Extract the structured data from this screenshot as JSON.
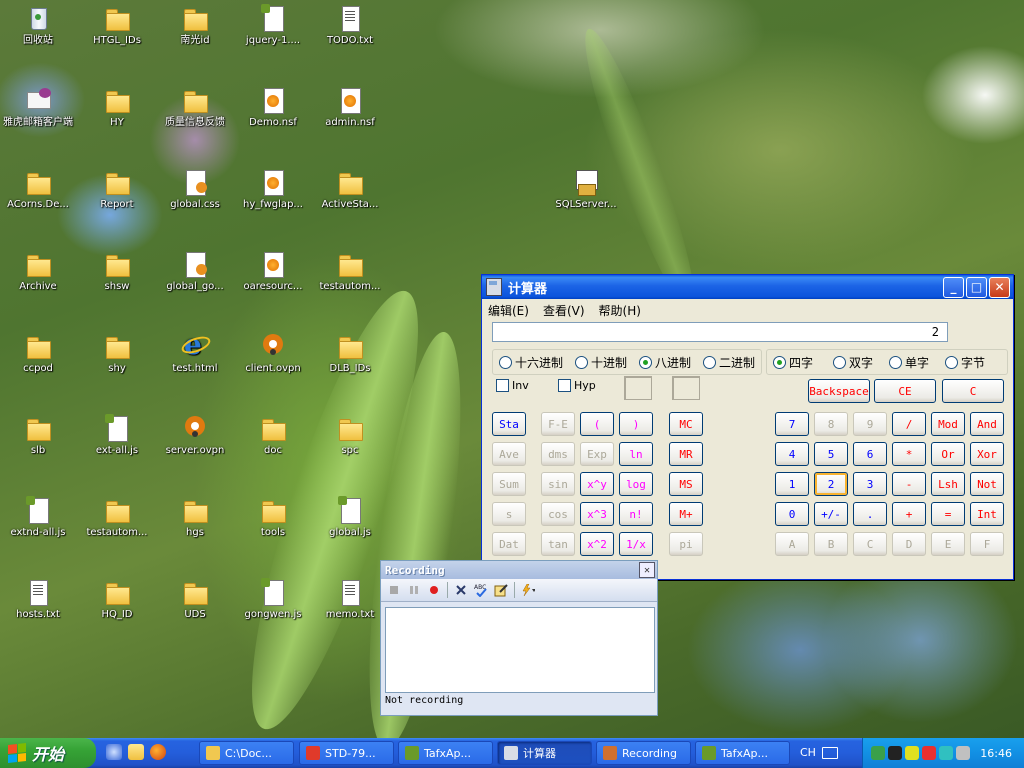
{
  "desktop": {
    "icons": [
      {
        "label": "回收站",
        "type": "recycle"
      },
      {
        "label": "HTGL_IDs",
        "type": "folder"
      },
      {
        "label": "南光id",
        "type": "folder"
      },
      {
        "label": "jquery-1....",
        "type": "js"
      },
      {
        "label": "TODO.txt",
        "type": "txt"
      },
      {
        "label": "雅虎邮箱客户端",
        "type": "mail"
      },
      {
        "label": "HY",
        "type": "folder"
      },
      {
        "label": "质量信息反馈",
        "type": "folder"
      },
      {
        "label": "Demo.nsf",
        "type": "nsf"
      },
      {
        "label": "admin.nsf",
        "type": "nsf"
      },
      {
        "label": "ACorns.De...",
        "type": "folder"
      },
      {
        "label": "Report",
        "type": "folder"
      },
      {
        "label": "global.css",
        "type": "css"
      },
      {
        "label": "hy_fwglap...",
        "type": "nsf"
      },
      {
        "label": "ActiveSta...",
        "type": "folder"
      },
      {
        "label": "SQLServer...",
        "type": "sql"
      },
      {
        "label": "Archive",
        "type": "folder"
      },
      {
        "label": "shsw",
        "type": "folder"
      },
      {
        "label": "global_go...",
        "type": "css"
      },
      {
        "label": "oaresourc...",
        "type": "nsf"
      },
      {
        "label": "testautom...",
        "type": "folder"
      },
      {
        "label": "ccpod",
        "type": "folder"
      },
      {
        "label": "shy",
        "type": "folder"
      },
      {
        "label": "test.html",
        "type": "ie"
      },
      {
        "label": "client.ovpn",
        "type": "vpn"
      },
      {
        "label": "DLB_IDs",
        "type": "folder"
      },
      {
        "label": "slb",
        "type": "folder"
      },
      {
        "label": "ext-all.js",
        "type": "js"
      },
      {
        "label": "server.ovpn",
        "type": "vpn"
      },
      {
        "label": "doc",
        "type": "folder"
      },
      {
        "label": "spc",
        "type": "folder"
      },
      {
        "label": "extnd-all.js",
        "type": "js"
      },
      {
        "label": "testautom...",
        "type": "folder"
      },
      {
        "label": "hgs",
        "type": "folder"
      },
      {
        "label": "tools",
        "type": "folder"
      },
      {
        "label": "global.js",
        "type": "js"
      },
      {
        "label": "hosts.txt",
        "type": "txt"
      },
      {
        "label": "HQ_ID",
        "type": "folder"
      },
      {
        "label": "UDS",
        "type": "folder"
      },
      {
        "label": "gongwen.js",
        "type": "js"
      },
      {
        "label": "memo.txt",
        "type": "txt"
      }
    ]
  },
  "calculator": {
    "title": "计算器",
    "menu": [
      "编辑(E)",
      "查看(V)",
      "帮助(H)"
    ],
    "display": "2",
    "base_options": [
      "十六进制",
      "十进制",
      "八进制",
      "二进制"
    ],
    "base_selected": "八进制",
    "word_options": [
      "四字",
      "双字",
      "单字",
      "字节"
    ],
    "word_selected": "四字",
    "inv_label": "Inv",
    "hyp_label": "Hyp",
    "backspace": "Backspace",
    "ce": "CE",
    "c": "C",
    "sci_buttons": [
      [
        "Sta",
        "F-E",
        "(",
        ")"
      ],
      [
        "Ave",
        "dms",
        "Exp",
        "ln"
      ],
      [
        "Sum",
        "sin",
        "x^y",
        "log"
      ],
      [
        "s",
        "cos",
        "x^3",
        "n!"
      ],
      [
        "Dat",
        "tan",
        "x^2",
        "1/x"
      ]
    ],
    "mem_buttons": [
      "MC",
      "MR",
      "MS",
      "M+",
      "pi"
    ],
    "num_buttons": [
      [
        "7",
        "8",
        "9",
        "/",
        "Mod",
        "And"
      ],
      [
        "4",
        "5",
        "6",
        "*",
        "Or",
        "Xor"
      ],
      [
        "1",
        "2",
        "3",
        "-",
        "Lsh",
        "Not"
      ],
      [
        "0",
        "+/-",
        ".",
        "+",
        "=",
        "Int"
      ],
      [
        "A",
        "B",
        "C",
        "D",
        "E",
        "F"
      ]
    ]
  },
  "recording": {
    "title": "Recording",
    "status": "Not recording",
    "close": "✕",
    "tools": [
      "stop-icon",
      "pause-icon",
      "record-icon",
      "delete-icon",
      "spellcheck-icon",
      "edit-icon",
      "lightning-icon"
    ]
  },
  "taskbar": {
    "start_label": "开始",
    "tasks": [
      {
        "label": "C:\\Doc..."
      },
      {
        "label": "STD-79..."
      },
      {
        "label": "TafxAp..."
      },
      {
        "label": "计算器"
      },
      {
        "label": "Recording"
      },
      {
        "label": "TafxAp..."
      }
    ],
    "lang": "CH",
    "clock": "16:46"
  }
}
